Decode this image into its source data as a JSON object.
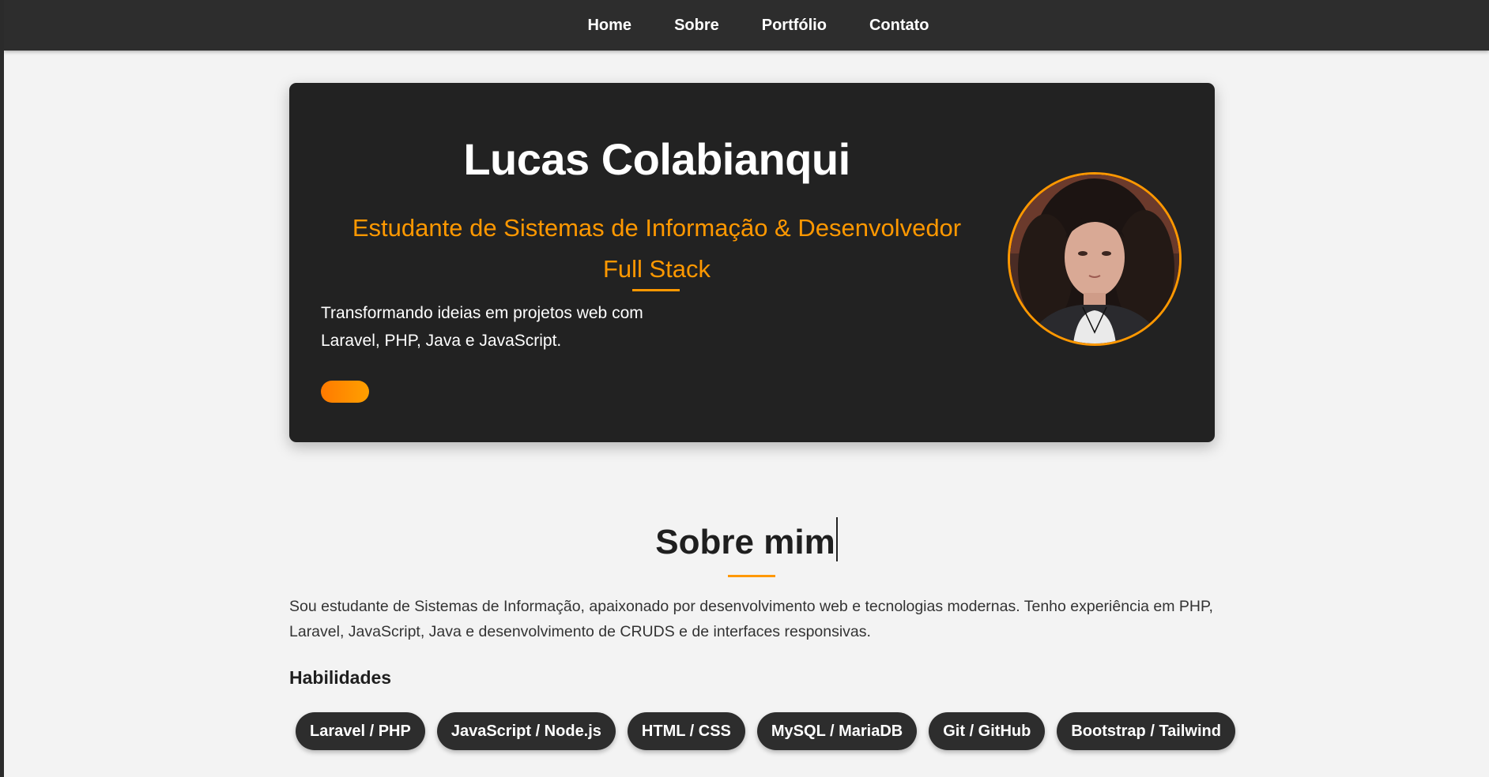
{
  "nav": {
    "items": [
      {
        "label": "Home"
      },
      {
        "label": "Sobre"
      },
      {
        "label": "Portfólio"
      },
      {
        "label": "Contato"
      }
    ]
  },
  "hero": {
    "name": "Lucas Colabianqui",
    "subtitle_line1": "Estudante de Sistemas de Informação & Desenvolvedor",
    "subtitle_line2": "Full Stack",
    "description_line1": "Transformando ideias em projetos web com",
    "description_line2": "Laravel, PHP, Java e JavaScript.",
    "button_label": "",
    "avatar_icon": "profile-photo"
  },
  "about": {
    "title": "Sobre mim",
    "text": "Sou estudante de Sistemas de Informação, apaixonado por desenvolvimento web e tecnologias modernas. Tenho experiência em PHP, Laravel, JavaScript, Java e desenvolvimento de CRUDS e de interfaces responsivas.",
    "skills_heading": "Habilidades",
    "skills": [
      "Laravel / PHP",
      "JavaScript / Node.js",
      "HTML / CSS",
      "MySQL / MariaDB",
      "Git / GitHub",
      "Bootstrap / Tailwind"
    ]
  },
  "colors": {
    "accent": "#ff9800",
    "dark": "#222222",
    "navbar": "#2d2d2d",
    "background": "#f3f3f3"
  }
}
